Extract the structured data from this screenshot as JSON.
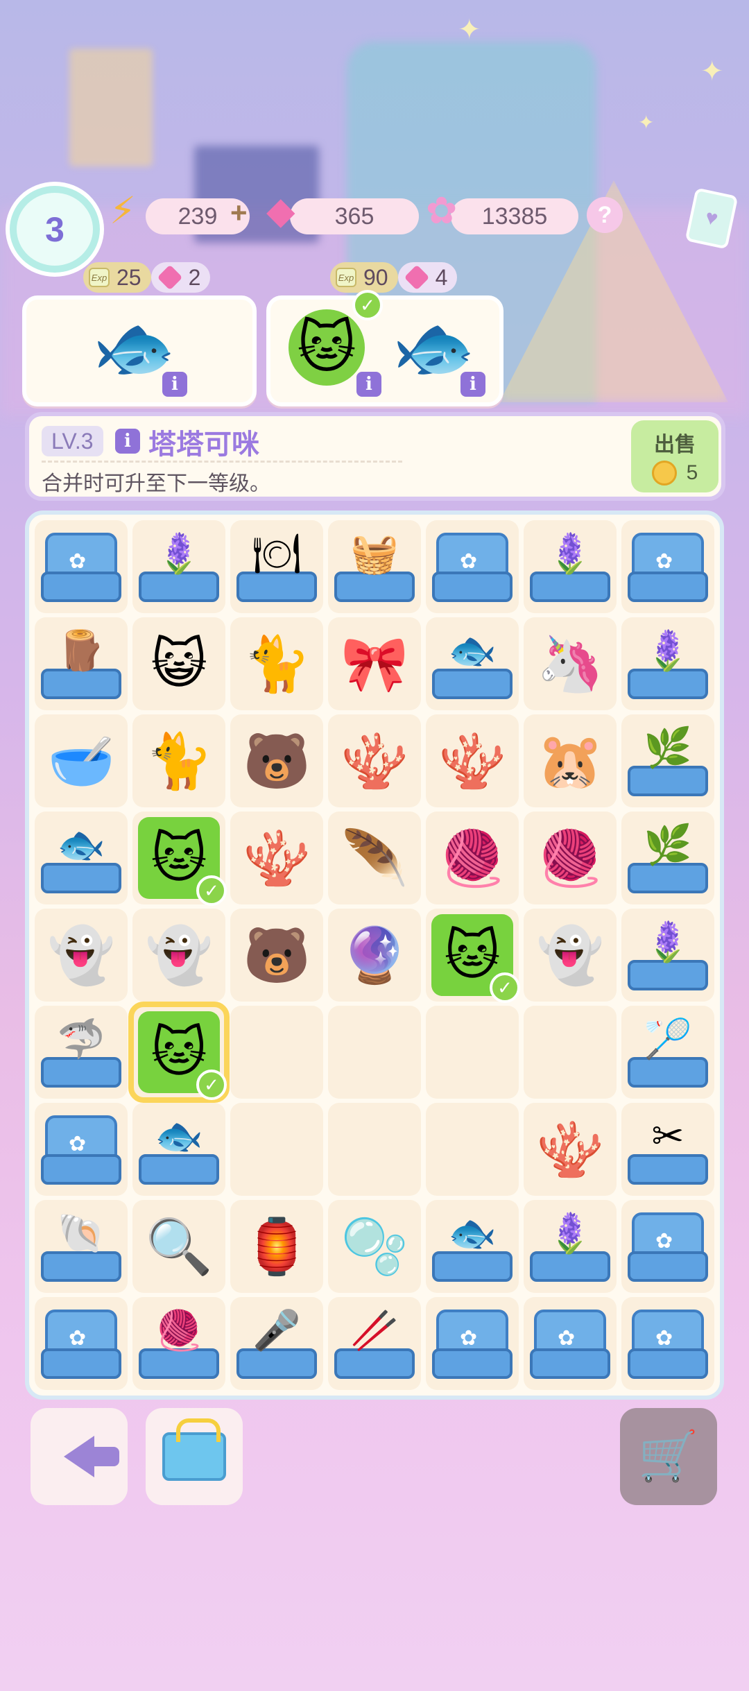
{
  "player": {
    "level": "3"
  },
  "resources": {
    "energy": "239",
    "energy_plus": "+",
    "gems": "365",
    "stars": "13385",
    "help": "?"
  },
  "orders": [
    {
      "exp": "25",
      "gems": "2",
      "items": [
        "goldfish"
      ],
      "completed": false
    },
    {
      "exp": "90",
      "gems": "4",
      "items": [
        "siamese-cat",
        "goldfish"
      ],
      "completed": true
    }
  ],
  "exp_icon_text": "Exp",
  "info_icon_text": "i",
  "selected_item": {
    "level": "LV.3",
    "name": "塔塔可咪",
    "description": "合并时可升至下一等级。",
    "sell_label": "出售",
    "sell_price": "5"
  },
  "board": {
    "rows": [
      [
        "box",
        "bin-flower",
        "bin-plate",
        "bin-basket",
        "box",
        "bin-flower",
        "box"
      ],
      [
        "bin-wood",
        "cat-white",
        "cat-orange",
        "jelly-pink",
        "bin-fish",
        "cat-unicorn",
        "bin-flower"
      ],
      [
        "bowl",
        "cat-brown",
        "bear-diaper",
        "coral-orange",
        "coral-orange-big",
        "hamster",
        "bin-branch"
      ],
      [
        "bin-fish-gray",
        "siamese",
        "coral-small",
        "feather",
        "yarn-pink",
        "yarn-double",
        "bin-branch"
      ],
      [
        "ghost",
        "ghost-stitch",
        "bear-diaper",
        "spinning-top",
        "siamese",
        "ghost-stitch",
        "bin-flower"
      ],
      [
        "bin-shark",
        "siamese",
        "",
        "",
        "",
        "",
        "bin-racket"
      ],
      [
        "box",
        "bin-fish",
        "",
        "",
        "",
        "coral-pink",
        "bin-scissors"
      ],
      [
        "bin-shell",
        "magnifier",
        "lantern",
        "bubble",
        "bin-fish",
        "bin-flower",
        "box"
      ],
      [
        "box",
        "bin-yarn",
        "bin-mic",
        "bin-tweezers",
        "box",
        "box",
        "box"
      ]
    ],
    "highlighted": [
      [
        3,
        1
      ],
      [
        4,
        4
      ],
      [
        5,
        1
      ]
    ],
    "selected": [
      5,
      1
    ]
  },
  "icons": {
    "goldfish": "🐟",
    "siamese-cat": "🐱",
    "cat-white": "😺",
    "cat-orange": "🐈",
    "jelly-pink": "🎀",
    "cat-unicorn": "🦄",
    "bowl": "🥣",
    "cat-brown": "🐈",
    "bear-diaper": "🐻",
    "coral-orange": "🪸",
    "coral-orange-big": "🪸",
    "hamster": "🐹",
    "siamese": "🐱",
    "coral-small": "🪸",
    "feather": "🪶",
    "yarn-pink": "🧶",
    "yarn-double": "🧶",
    "ghost": "👻",
    "ghost-stitch": "👻",
    "spinning-top": "🔮",
    "coral-pink": "🪸",
    "magnifier": "🔍",
    "lantern": "🏮",
    "bubble": "🫧",
    "bin-flower": "🪻",
    "bin-plate": "🍽",
    "bin-basket": "🧺",
    "bin-wood": "🪵",
    "bin-fish": "🐟",
    "bin-branch": "🌿",
    "bin-fish-gray": "🐟",
    "bin-shark": "🦈",
    "bin-racket": "🏸",
    "bin-scissors": "✂",
    "bin-shell": "🐚",
    "bin-yarn": "🧶",
    "bin-mic": "🎤",
    "bin-tweezers": "🥢"
  },
  "colors": {
    "accent_purple": "#9b7ae0",
    "highlight_green": "#78d23e",
    "select_yellow": "#fbd55a",
    "box_blue": "#5ea2e2"
  },
  "buttons": {
    "back": "back-arrow-icon",
    "inventory": "inventory-box-icon",
    "shop": "shopping-cart-icon"
  }
}
